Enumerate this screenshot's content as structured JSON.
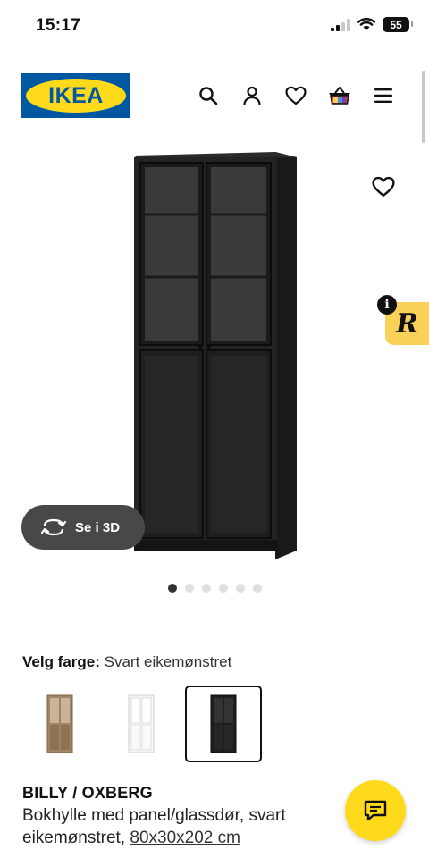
{
  "status_bar": {
    "time": "15:17",
    "battery_level": "55"
  },
  "header": {
    "logo_text": "IKEA",
    "icons": [
      "search-icon",
      "account-icon",
      "heart-icon",
      "basket-icon",
      "menu-icon"
    ]
  },
  "gallery": {
    "view_3d_label": "Se i 3D",
    "image_count": 6,
    "active_index": 0
  },
  "color_picker": {
    "label": "Velg farge:",
    "selected_value": "Svart eikemønstret",
    "swatches": [
      {
        "color": "#A08565",
        "selected": false
      },
      {
        "color": "#FFFFFF",
        "selected": false
      },
      {
        "color": "#1E1E1E",
        "selected": true
      }
    ]
  },
  "product": {
    "name": "BILLY / OXBERG",
    "description": "Bokhylle med panel/glassdør, svart eikemønstret, ",
    "size": "80x30x202 cm"
  },
  "colors": {
    "ikea_blue": "#0058A3",
    "ikea_yellow": "#FFDA1A",
    "dark_button": "#484848"
  }
}
